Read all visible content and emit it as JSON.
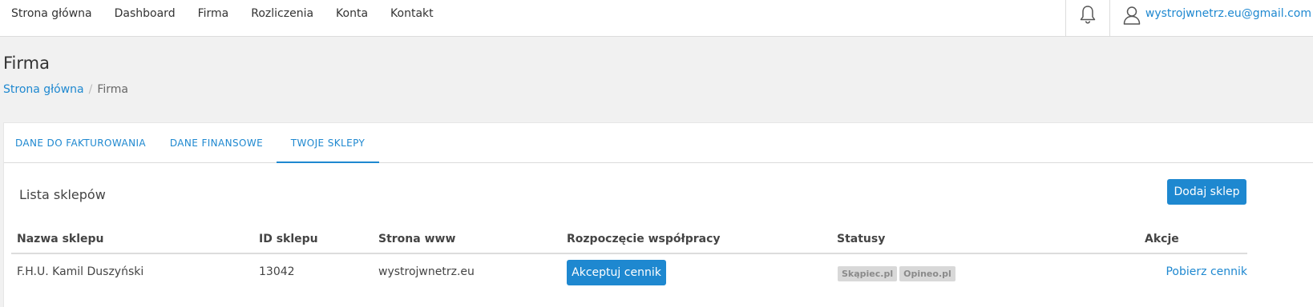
{
  "nav": {
    "links": [
      "Strona główna",
      "Dashboard",
      "Firma",
      "Rozliczenia",
      "Konta",
      "Kontakt"
    ],
    "user_email": "wystrojwnetrz.eu@gmail.com"
  },
  "page": {
    "title": "Firma",
    "breadcrumb": {
      "home": "Strona główna",
      "separator": "/",
      "current": "Firma"
    }
  },
  "tabs": [
    {
      "label": "DANE DO FAKTUROWANIA",
      "active": false
    },
    {
      "label": "DANE FINANSOWE",
      "active": false
    },
    {
      "label": "TWOJE SKLEPY",
      "active": true
    }
  ],
  "shops": {
    "title": "Lista sklepów",
    "add_button": "Dodaj sklep",
    "columns": {
      "name": "Nazwa sklepu",
      "id": "ID sklepu",
      "www": "Strona www",
      "start": "Rozpoczęcie współpracy",
      "status": "Statusy",
      "actions": "Akcje"
    },
    "rows": [
      {
        "name": "F.H.U. Kamil Duszyński",
        "id": "13042",
        "www": "wystrojwnetrz.eu",
        "accept_button": "Akceptuj cennik",
        "statuses": [
          "Skąpiec.pl",
          "Opineo.pl"
        ],
        "action_link": "Pobierz cennik"
      }
    ]
  },
  "colors": {
    "accent": "#1e88d0",
    "page_bg": "#f1f1f1",
    "badge_bg": "#d8d8d8"
  },
  "icons": {
    "notifications": "bell-icon",
    "user": "user-icon"
  }
}
